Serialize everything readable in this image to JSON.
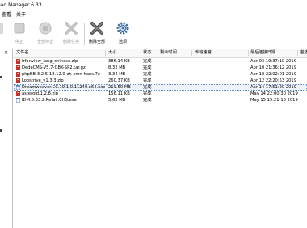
{
  "title": "oad Manager 6.33",
  "menu": [
    "查看",
    "关于"
  ],
  "toolbar": [
    {
      "label": "停止",
      "icon": "stop-icon",
      "enabled": false
    },
    {
      "label": "全部停止",
      "icon": "stop-all-icon",
      "enabled": false
    },
    {
      "label": "删除任务",
      "icon": "delete-task-icon",
      "enabled": false
    },
    {
      "label": "删除全部",
      "icon": "delete-all-icon",
      "enabled": true
    },
    {
      "label": "选项",
      "icon": "options-icon",
      "enabled": true
    }
  ],
  "sidebar": {
    "close": "✕"
  },
  "columns": {
    "name": "文件名",
    "size": "大小",
    "status": "状态",
    "time_left": "剩余时间",
    "speed": "传输速度",
    "last_try": "最后连接日期",
    "description": "描述"
  },
  "files": [
    {
      "name": "irfanview_lang_chinese.zip",
      "size": "386.14 KB",
      "status": "完成",
      "date": "Apr 03 19:37:10 2019",
      "icon": "archive-file-icon"
    },
    {
      "name": "DedeCMS-V5.7-GBK-SP2.tar.gz",
      "size": "8.32 MB",
      "status": "完成",
      "date": "Apr 10 21:36:12 2019",
      "icon": "archive-file-icon"
    },
    {
      "name": "phpBB-3.2.5-18.12.0-zh-cmn-hans.7z",
      "size": "3.34 MB",
      "status": "完成",
      "date": "Apr 10 22:02:01 2019",
      "icon": "archive-file-icon"
    },
    {
      "name": "Loostrive_v1.3.3.zip",
      "size": "260.37 KB",
      "status": "完成",
      "date": "Apr 12 22:20:53 2019",
      "icon": "archive-file-icon"
    },
    {
      "name": "Dreamweaver.CC.19.1.0.11240.x64.exe",
      "size": "219.50 MB",
      "status": "完成",
      "date": "Apr 14 17:51:20 2019",
      "icon": "program-file-icon"
    },
    {
      "name": "asteroid.1.2.8.zip",
      "size": "156.11 KB",
      "status": "完成",
      "date": "May 14 22:00:30 2019",
      "icon": "archive-file-icon"
    },
    {
      "name": "IDM.6.33.2.Retail.CHS.exe",
      "size": "5.62 MB",
      "status": "完成",
      "date": "May 15 19:21:16 2019",
      "icon": "program-file-icon"
    }
  ],
  "colors": {
    "archive_red": "#c8302c",
    "program_blue": "#3a6fb8",
    "selection": "#eef3fb"
  }
}
